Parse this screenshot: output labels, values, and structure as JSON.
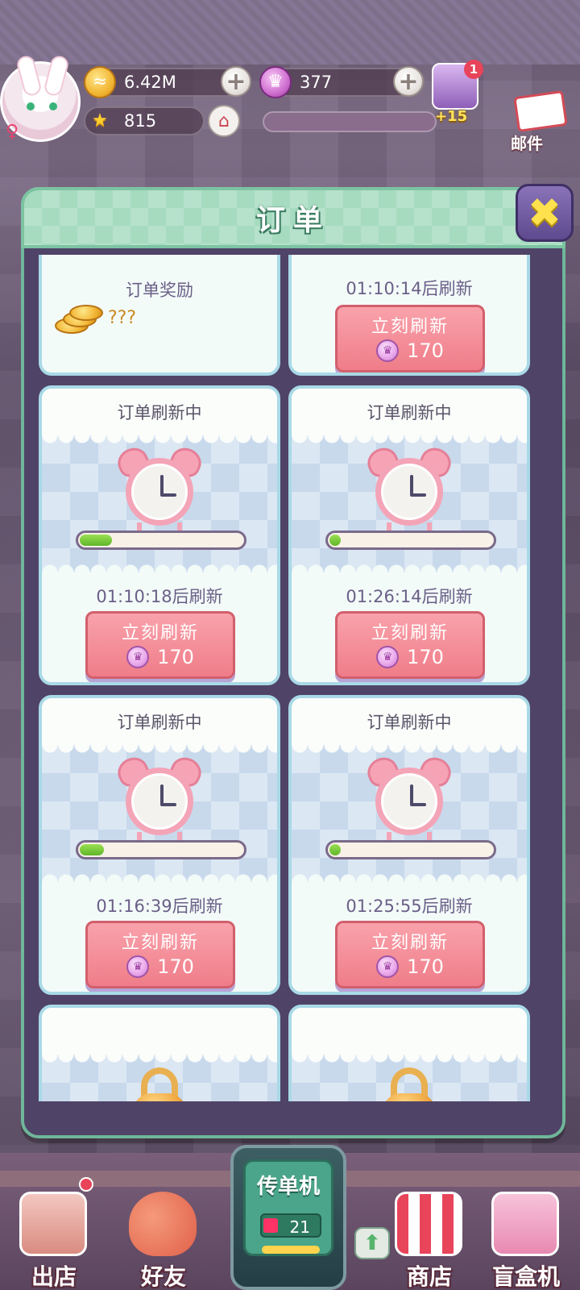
{
  "hud": {
    "coins": "6.42M",
    "gems": "377",
    "stars": "815",
    "char_badge": "1",
    "bonus": "+15",
    "mail_label": "邮件"
  },
  "modal": {
    "title": "订单",
    "close_icon": "close-x-icon"
  },
  "cards": [
    {
      "type": "reward",
      "title": "订单奖励",
      "value": "???"
    },
    {
      "type": "partial",
      "timer": "01:10:14后刷新",
      "button_label": "立刻刷新",
      "cost": "170"
    },
    {
      "type": "refreshing",
      "title": "订单刷新中",
      "progress": 0.2,
      "timer": "01:10:18后刷新",
      "button_label": "立刻刷新",
      "cost": "170"
    },
    {
      "type": "refreshing",
      "title": "订单刷新中",
      "progress": 0.03,
      "timer": "01:26:14后刷新",
      "button_label": "立刻刷新",
      "cost": "170"
    },
    {
      "type": "refreshing",
      "title": "订单刷新中",
      "progress": 0.15,
      "timer": "01:16:39后刷新",
      "button_label": "立刻刷新",
      "cost": "170"
    },
    {
      "type": "refreshing",
      "title": "订单刷新中",
      "progress": 0.03,
      "timer": "01:25:55后刷新",
      "button_label": "立刻刷新",
      "cost": "170"
    },
    {
      "type": "locked"
    },
    {
      "type": "locked"
    }
  ],
  "bottom_nav": {
    "leave": "出店",
    "friends": "好友",
    "flyer_title": "传单机",
    "flyer_count": "21",
    "shop": "商店",
    "blindbox": "盲盒机"
  },
  "colors": {
    "accent_green": "#a6dbbf",
    "button_pink": "#ef7d89",
    "modal_bg": "#4f4367"
  }
}
